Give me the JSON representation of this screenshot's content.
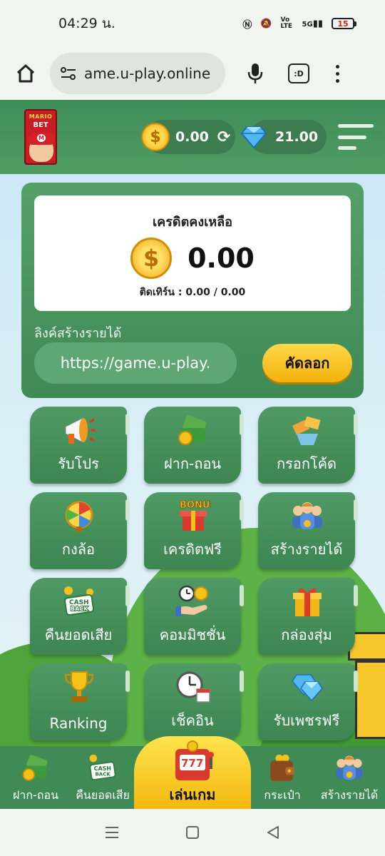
{
  "status_bar": {
    "time": "04:29 น.",
    "network": "5G",
    "volte": "Vo LTE",
    "battery": "15"
  },
  "browser": {
    "url": "ame.u-play.online",
    "tabs_label": ":D"
  },
  "header": {
    "logo_top": "MARIO",
    "logo_text": "BET",
    "coin_balance": "0.00",
    "gem_balance": "21.00"
  },
  "credit": {
    "title": "เครดิตคงเหลือ",
    "amount": "0.00",
    "turnover": "ติดเทิร์น : 0.00 / 0.00",
    "link_label": "ลิงค์สร้างรายได้",
    "link_value": "https://game.u-play.",
    "copy_label": "คัดลอก"
  },
  "menu": [
    {
      "label": "รับโปร",
      "icon": "megaphone-icon"
    },
    {
      "label": "ฝาก-ถอน",
      "icon": "money-icon"
    },
    {
      "label": "กรอกโค้ด",
      "icon": "tickets-icon"
    },
    {
      "label": "กงล้อ",
      "icon": "wheel-icon"
    },
    {
      "label": "เครดิตฟรี",
      "icon": "bonus-box-icon"
    },
    {
      "label": "สร้างรายได้",
      "icon": "team-icon"
    },
    {
      "label": "คืนยอดเสีย",
      "icon": "cashback-icon"
    },
    {
      "label": "คอมมิชชั่น",
      "icon": "commission-icon"
    },
    {
      "label": "กล่องสุ่ม",
      "icon": "gift-box-icon"
    },
    {
      "label": "Ranking",
      "icon": "trophy-icon"
    },
    {
      "label": "เช็คอิน",
      "icon": "clock-calendar-icon"
    },
    {
      "label": "รับเพชรฟรี",
      "icon": "diamond-icon"
    }
  ],
  "bottom_nav": {
    "deposit": "ฝาก-ถอน",
    "cashback": "คืนยอดเสีย",
    "play": "เล่นเกม",
    "wallet": "กระเป๋า",
    "earn": "สร้างรายได้"
  },
  "colors": {
    "primary_green": "#3f8a55",
    "accent_yellow": "#f2b20c",
    "sky": "#c7e6f4"
  }
}
